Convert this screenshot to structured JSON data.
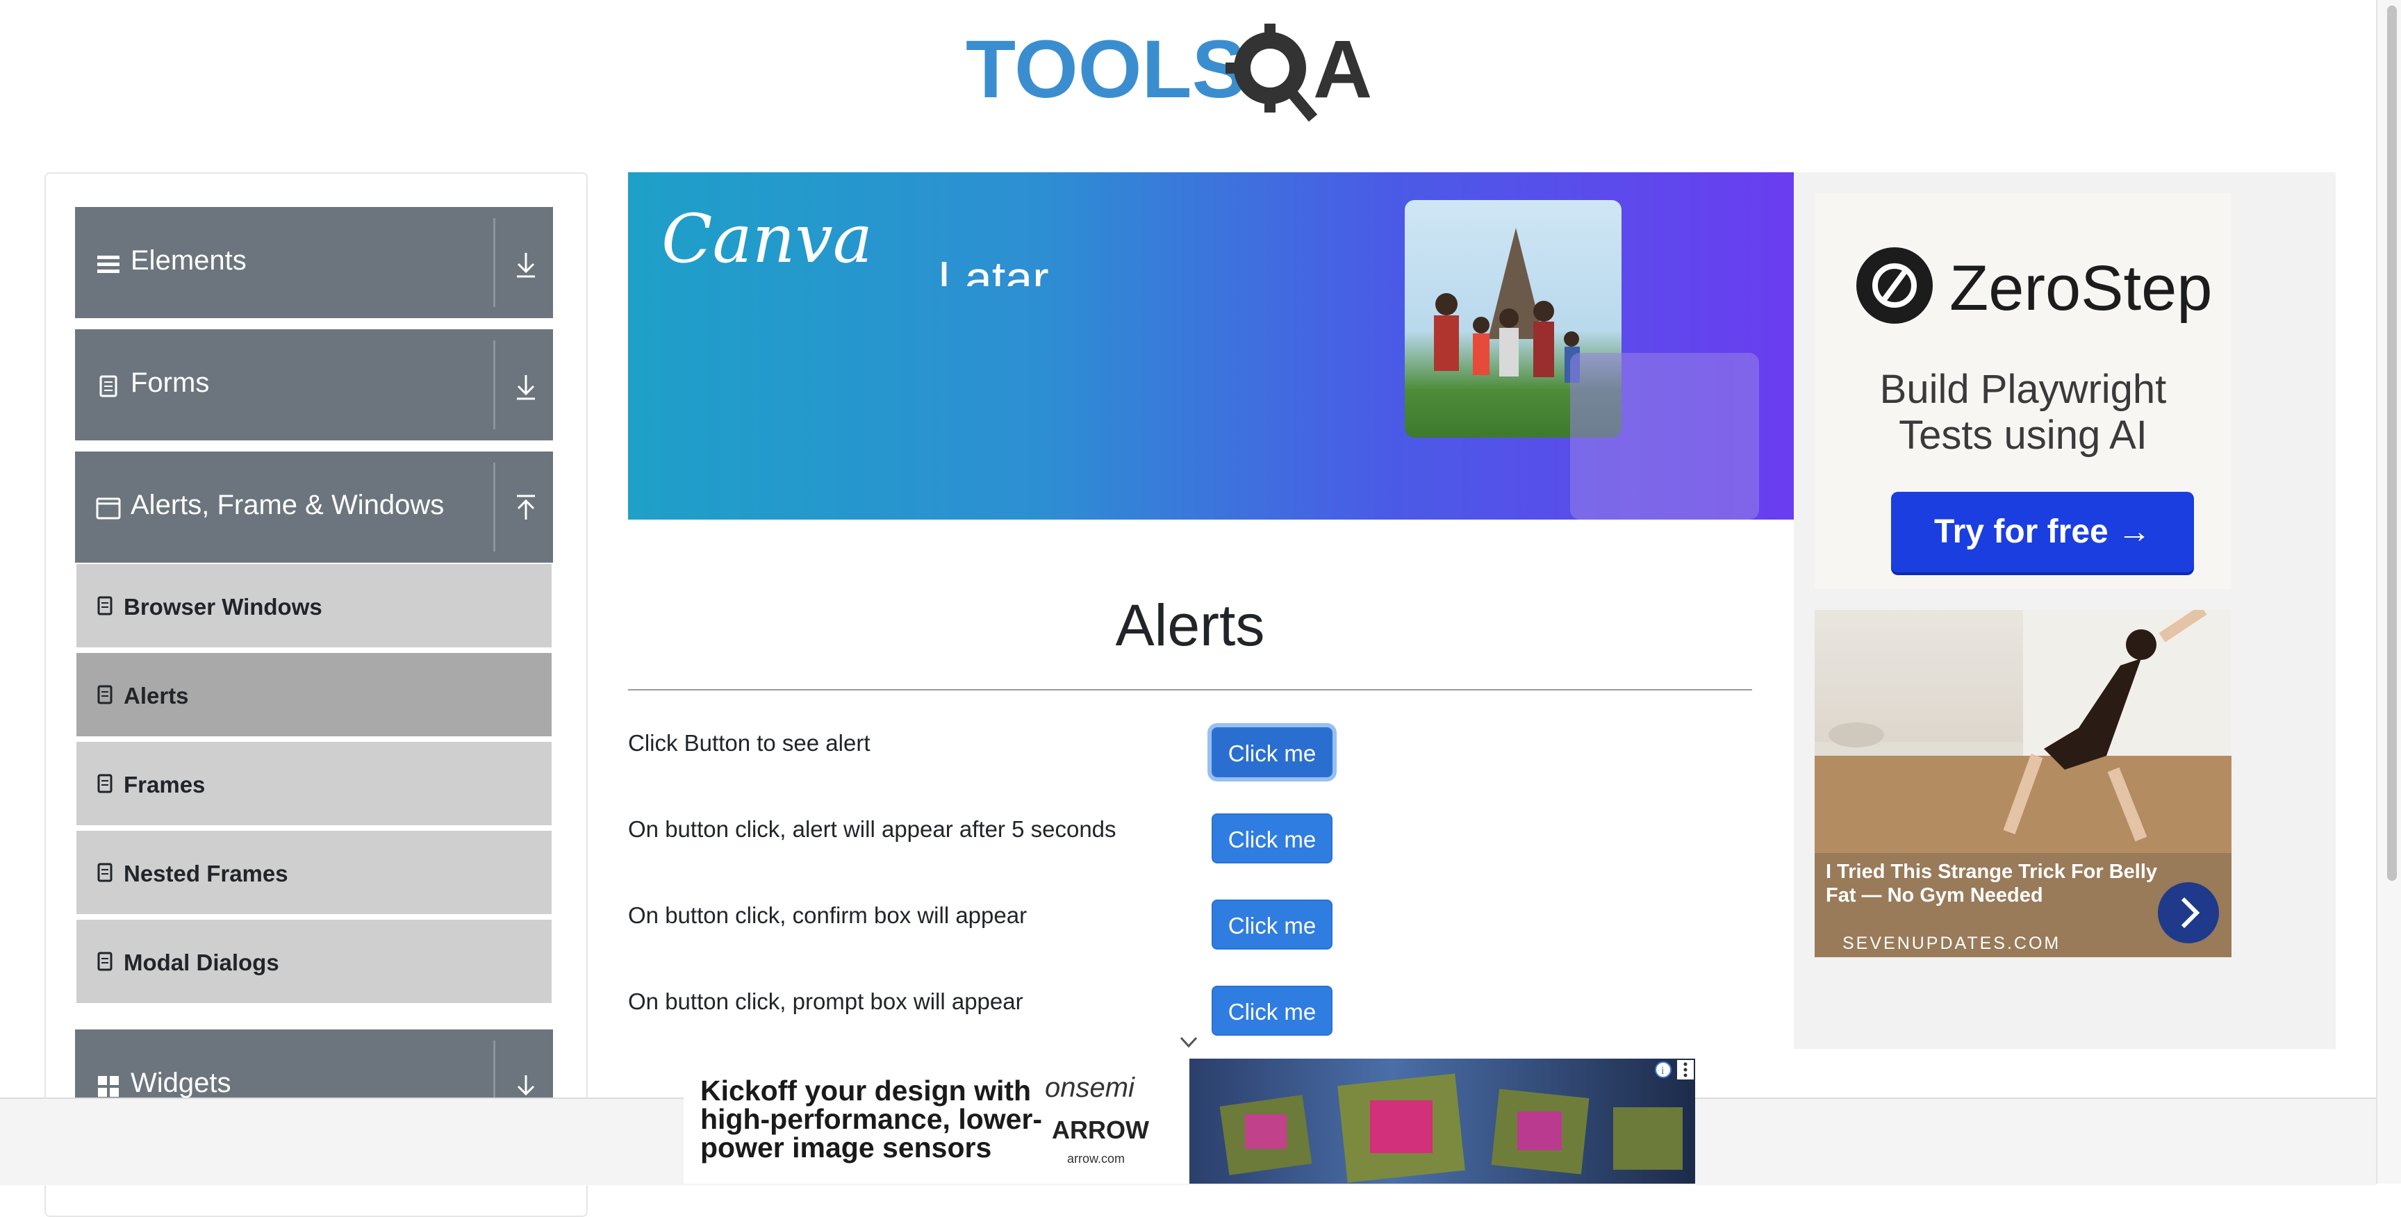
{
  "header": {
    "logo_text": "TOOLSQA"
  },
  "sidebar": {
    "groups": [
      {
        "label": "Elements",
        "icon": "hamburger-icon",
        "expanded": false
      },
      {
        "label": "Forms",
        "icon": "document-icon",
        "expanded": false
      },
      {
        "label": "Alerts, Frame & Windows",
        "icon": "window-icon",
        "expanded": true
      },
      {
        "label": "Widgets",
        "icon": "grid-icon",
        "expanded": false
      }
    ],
    "items": [
      {
        "label": "Browser Windows",
        "active": false
      },
      {
        "label": "Alerts",
        "active": true
      },
      {
        "label": "Frames",
        "active": false
      },
      {
        "label": "Nested Frames",
        "active": false
      },
      {
        "label": "Modal Dialogs",
        "active": false
      }
    ]
  },
  "banner": {
    "brand": "Canva",
    "headline": "Latar"
  },
  "main": {
    "title": "Alerts",
    "rows": [
      {
        "label": "Click Button to see alert",
        "button": "Click me"
      },
      {
        "label": "On button click, alert will appear after 5 seconds",
        "button": "Click me"
      },
      {
        "label": "On button click, confirm box will appear",
        "button": "Click me"
      },
      {
        "label": "On button click, prompt box will appear",
        "button": "Click me"
      }
    ]
  },
  "right_ad": {
    "brand": "ZeroStep",
    "tagline_1": "Build Playwright",
    "tagline_2": "Tests using AI",
    "cta": "Try for free →",
    "story_title": "I Tried This Strange Trick For Belly Fat — No Gym Needed",
    "story_source": "SEVENUPDATES.COM"
  },
  "bottom_ad": {
    "text": "Kickoff your design with high-performance, lower-power image sensors",
    "brand_1": "onsemi",
    "brand_2": "ARROW",
    "brand_3": "arrow.com"
  },
  "colors": {
    "sidebar_group": "#6c757d",
    "sidebar_item": "#cfcfcf",
    "sidebar_item_active": "#a9a9a9",
    "button_primary": "#2f7de1",
    "logo_blue": "#3a8ed0",
    "logo_dark": "#333333"
  }
}
